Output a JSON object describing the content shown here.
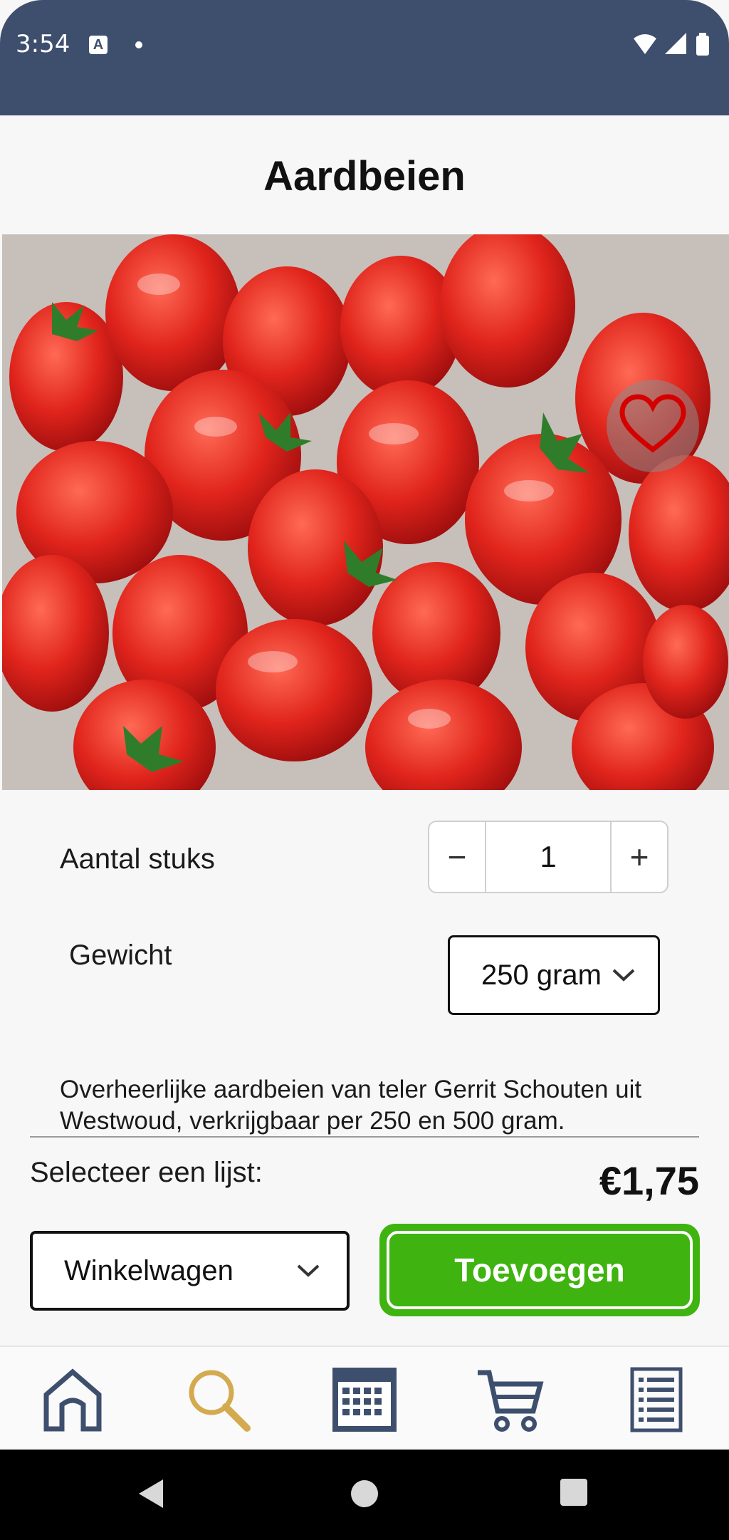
{
  "status_bar": {
    "time": "3:54",
    "notification_badge": "A"
  },
  "product": {
    "title": "Aardbeien",
    "image_alt": "Aardbeien",
    "favorite_icon": "heart-outline-icon"
  },
  "quantity": {
    "label": "Aantal stuks",
    "minus": "−",
    "value": "1",
    "plus": "+"
  },
  "weight": {
    "label": "Gewicht",
    "selected": "250 gram"
  },
  "description": "Overheerlijke aardbeien van teler Gerrit Schouten uit Westwoud, verkrijgbaar per 250 en 500 gram.",
  "list": {
    "label": "Selecteer een lijst:",
    "selected": "Winkelwagen"
  },
  "price": "€1,75",
  "add_button": "Toevoegen",
  "bottom_nav": [
    {
      "icon": "home-icon",
      "active": false
    },
    {
      "icon": "search-icon",
      "active": true
    },
    {
      "icon": "calendar-icon",
      "active": false
    },
    {
      "icon": "cart-icon",
      "active": false
    },
    {
      "icon": "list-icon",
      "active": false
    }
  ],
  "colors": {
    "header": "#3e4f6e",
    "nav_icon": "#3e4f6e",
    "nav_active": "#d4aa50",
    "add_button": "#3fb30f",
    "heart": "#d40000"
  }
}
